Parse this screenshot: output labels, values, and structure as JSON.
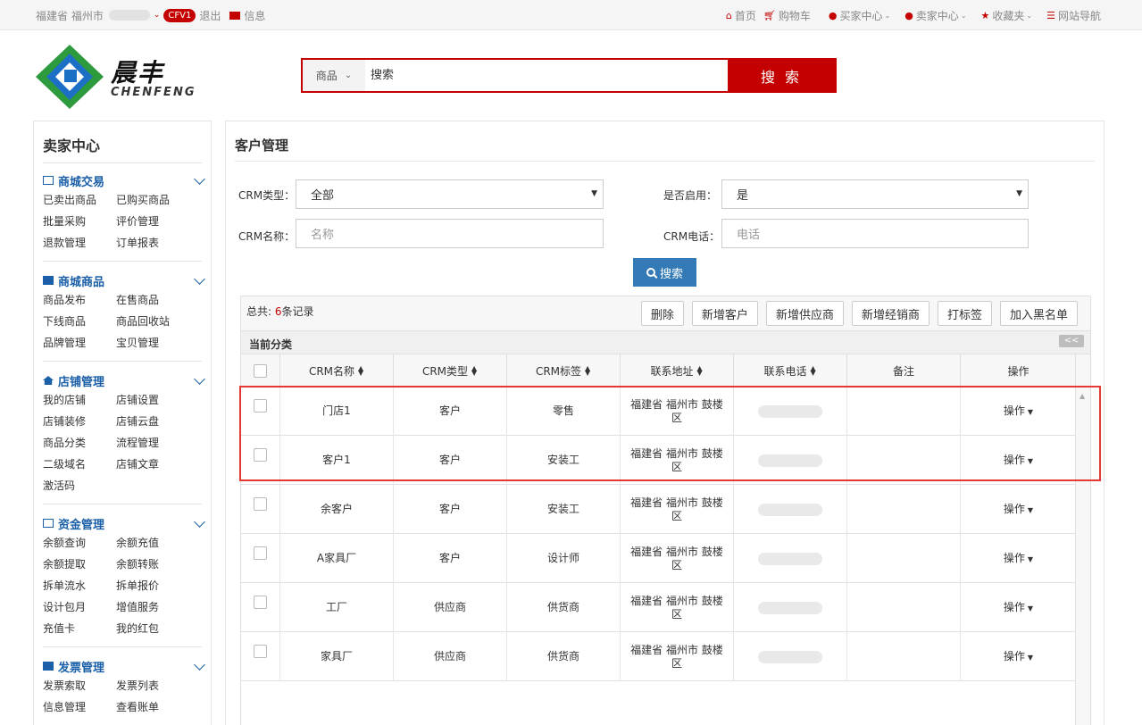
{
  "topbar": {
    "location": "福建省 福州市",
    "vip": "CFV1",
    "logout": "退出",
    "message": "信息",
    "right": [
      {
        "label": "首页",
        "icon": "home-icon"
      },
      {
        "label": "购物车",
        "icon": "cart-icon"
      },
      {
        "label": "买家中心",
        "icon": "user-icon"
      },
      {
        "label": "卖家中心",
        "icon": "user-icon"
      },
      {
        "label": "收藏夹",
        "icon": "star-icon"
      },
      {
        "label": "网站导航",
        "icon": "list-icon"
      }
    ]
  },
  "logo": {
    "cn": "晨丰",
    "en": "CHENFENG"
  },
  "search": {
    "category": "商品",
    "placeholder": "搜索",
    "button": "搜 索"
  },
  "sidebar": {
    "title": "卖家中心",
    "sections": [
      {
        "title": "商城交易",
        "icon": "card-icon",
        "items": [
          "已卖出商品",
          "已购买商品",
          "批量采购",
          "评价管理",
          "退款管理",
          "订单报表"
        ]
      },
      {
        "title": "商城商品",
        "icon": "truck-icon",
        "items": [
          "商品发布",
          "在售商品",
          "下线商品",
          "商品回收站",
          "品牌管理",
          "宝贝管理"
        ]
      },
      {
        "title": "店铺管理",
        "icon": "home-icon",
        "items": [
          "我的店铺",
          "店铺设置",
          "店铺装修",
          "店铺云盘",
          "商品分类",
          "流程管理",
          "二级域名",
          "店铺文章",
          "激活码"
        ]
      },
      {
        "title": "资金管理",
        "icon": "money-icon",
        "items": [
          "余额查询",
          "余额充值",
          "余额提取",
          "余额转账",
          "拆单流水",
          "拆单报价",
          "设计包月",
          "增值服务",
          "充值卡",
          "我的红包"
        ]
      },
      {
        "title": "发票管理",
        "icon": "envelope-icon",
        "items": [
          "发票索取",
          "发票列表",
          "信息管理",
          "查看账单"
        ]
      }
    ]
  },
  "main": {
    "title": "客户管理",
    "filters": {
      "crm_type_label": "CRM类型：",
      "crm_type_value": "全部",
      "enabled_label": "是否启用：",
      "enabled_value": "是",
      "name_label": "CRM名称：",
      "name_placeholder": "名称",
      "phone_label": "CRM电话：",
      "phone_placeholder": "电话",
      "search_button": "搜索"
    },
    "total_prefix": "总共: ",
    "total_count": "6",
    "total_suffix": "条记录",
    "buttons": [
      "删除",
      "新增客户",
      "新增供应商",
      "新增经销商",
      "打标签",
      "加入黑名单"
    ],
    "category_title": "当前分类",
    "collapse": "<<",
    "columns": [
      "CRM名称",
      "CRM类型",
      "CRM标签",
      "联系地址",
      "联系电话",
      "备注",
      "操作"
    ],
    "rows": [
      {
        "name": "门店1",
        "type": "客户",
        "tag": "零售",
        "address": "福建省 福州市 鼓楼区",
        "remark": "",
        "op": "操作"
      },
      {
        "name": "客户1",
        "type": "客户",
        "tag": "安装工",
        "address": "福建省 福州市 鼓楼区",
        "remark": "",
        "op": "操作"
      },
      {
        "name": "余客户",
        "type": "客户",
        "tag": "安装工",
        "address": "福建省 福州市 鼓楼区",
        "remark": "",
        "op": "操作"
      },
      {
        "name": "A家具厂",
        "type": "客户",
        "tag": "设计师",
        "address": "福建省 福州市 鼓楼区",
        "remark": "",
        "op": "操作"
      },
      {
        "name": "工厂",
        "type": "供应商",
        "tag": "供货商",
        "address": "福建省 福州市 鼓楼区",
        "remark": "",
        "op": "操作"
      },
      {
        "name": "家具厂",
        "type": "供应商",
        "tag": "供货商",
        "address": "福建省 福州市 鼓楼区",
        "remark": "",
        "op": "操作"
      }
    ]
  },
  "colors": {
    "brand_red": "#c40000",
    "link_blue": "#1a5fa8",
    "button_blue": "#337ab7",
    "highlight": "#e53935"
  }
}
